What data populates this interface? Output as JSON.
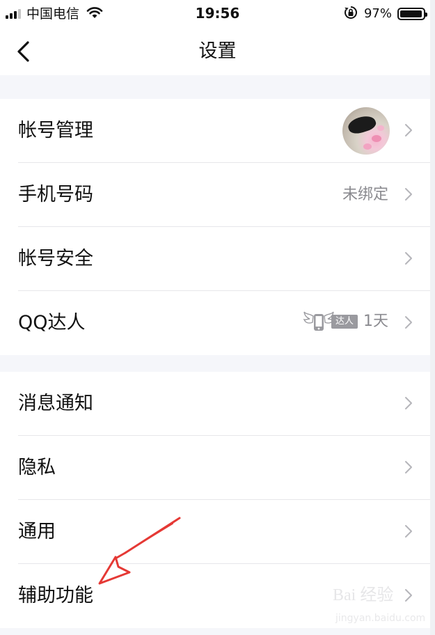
{
  "status_bar": {
    "carrier": "中国电信",
    "time": "19:56",
    "battery_percent": "97%",
    "battery_level": 0.97,
    "icons": [
      "signal-icon",
      "wifi-icon",
      "orientation-lock-icon",
      "battery-icon"
    ]
  },
  "nav": {
    "title": "设置",
    "back_icon": "chevron-left-icon"
  },
  "groups": [
    {
      "items": [
        {
          "label": "帐号管理",
          "accessory": "avatar"
        },
        {
          "label": "手机号码",
          "value": "未绑定"
        },
        {
          "label": "帐号安全"
        },
        {
          "label": "QQ达人",
          "badge_text": "达人",
          "days": "1天"
        }
      ]
    },
    {
      "items": [
        {
          "label": "消息通知"
        },
        {
          "label": "隐私"
        },
        {
          "label": "通用"
        },
        {
          "label": "辅助功能"
        }
      ]
    }
  ],
  "colors": {
    "background": "#f5f6fa",
    "cell": "#ffffff",
    "text": "#111111",
    "secondary": "#8a8a8f",
    "annotation_arrow": "#e53935"
  },
  "watermark": {
    "line1": "Bai 经验",
    "line2": "jingyan.baidu.com"
  }
}
